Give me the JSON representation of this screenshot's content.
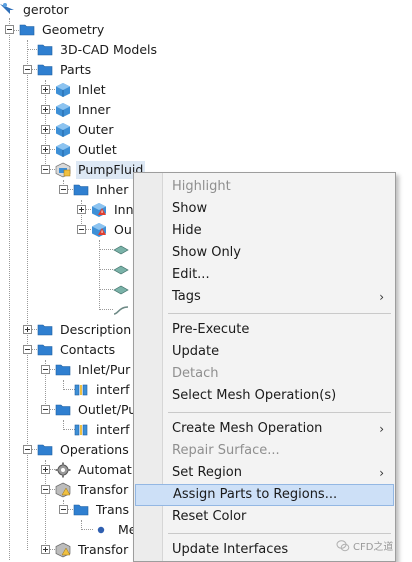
{
  "tree": {
    "root": "gerotor",
    "geometry": "Geometry",
    "cad_models": "3D-CAD Models",
    "parts": "Parts",
    "inlet": "Inlet",
    "inner": "Inner",
    "outer": "Outer",
    "outlet": "Outlet",
    "pumpfluid": "PumpFluid",
    "inher": "Inher",
    "inn": "Inn",
    "ou": "Ou",
    "description": "Description",
    "contacts": "Contacts",
    "inlet_pur": "Inlet/Pur",
    "interf1": "interf",
    "outlet_pu": "Outlet/Pu",
    "interf2": "interf",
    "operations": "Operations",
    "automat": "Automat",
    "transfor1": "Transfor",
    "trans": "Trans",
    "me": "Me",
    "transfor2": "Transfor"
  },
  "context_menu": {
    "highlight": "Highlight",
    "show": "Show",
    "hide": "Hide",
    "show_only": "Show Only",
    "edit": "Edit...",
    "tags": "Tags",
    "pre_execute": "Pre-Execute",
    "update": "Update",
    "detach": "Detach",
    "select_mesh_op": "Select Mesh Operation(s)",
    "create_mesh_op": "Create Mesh Operation",
    "repair_surface": "Repair Surface...",
    "set_region": "Set Region",
    "assign_parts": "Assign Parts to Regions...",
    "reset_color": "Reset Color",
    "update_interfaces": "Update Interfaces",
    "submenu_arrow": "›"
  },
  "watermark": "CFD之道",
  "colors": {
    "folder": "#2f7fd0",
    "part_blue": "#3d8fd6",
    "highlight": "#cde0f7",
    "selection": "#dde8f4"
  }
}
